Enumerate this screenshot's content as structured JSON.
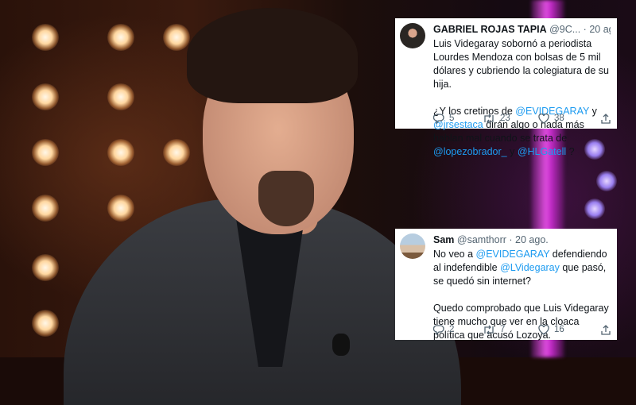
{
  "tweets": [
    {
      "name": "GABRIEL ROJAS TAPIA",
      "handle": "@9C...",
      "separator": "·",
      "date": "20 ago.",
      "para1": "Luis Videgaray sobornó a periodista Lourdes Mendoza con bolsas de 5 mil dólares y cubriendo la colegiatura de su hija.",
      "para2": {
        "t1": "¿Y los cretinos de ",
        "m1": "@EVIDEGARAY",
        "t2": " y ",
        "m2": "@jrsestaca",
        "t3": " dirán algo o nada más hablan mal cuando se trata de ",
        "m3": "@lopezobrador_",
        "t4": "  y ",
        "m4": "@HLGatell",
        "t5": " ?"
      },
      "replies": "5",
      "retweets": "23",
      "likes": "38"
    },
    {
      "name": "Sam",
      "handle": "@samthorr",
      "separator": "·",
      "date": "20 ago.",
      "para1": {
        "t1": "No veo a ",
        "m1": "@EVIDEGARAY",
        "t2": " defendiendo al indefendible ",
        "m2": "@LVidegaray",
        "t3": " que pasó, se quedó sin internet?"
      },
      "para2": "Quedo comprobado que Luis Videgaray tiene mucho que ver en la cloaca política que acusó Lozoya.",
      "replies": "2",
      "retweets": "7",
      "likes": "16"
    }
  ],
  "icons": {
    "reply": "speech-bubble",
    "retweet": "retweet-arrows",
    "like": "heart",
    "share": "share-arrow"
  },
  "colors": {
    "mention": "#1d9bf0",
    "secondary_text": "#536471",
    "card_bg": "#ffffff"
  }
}
